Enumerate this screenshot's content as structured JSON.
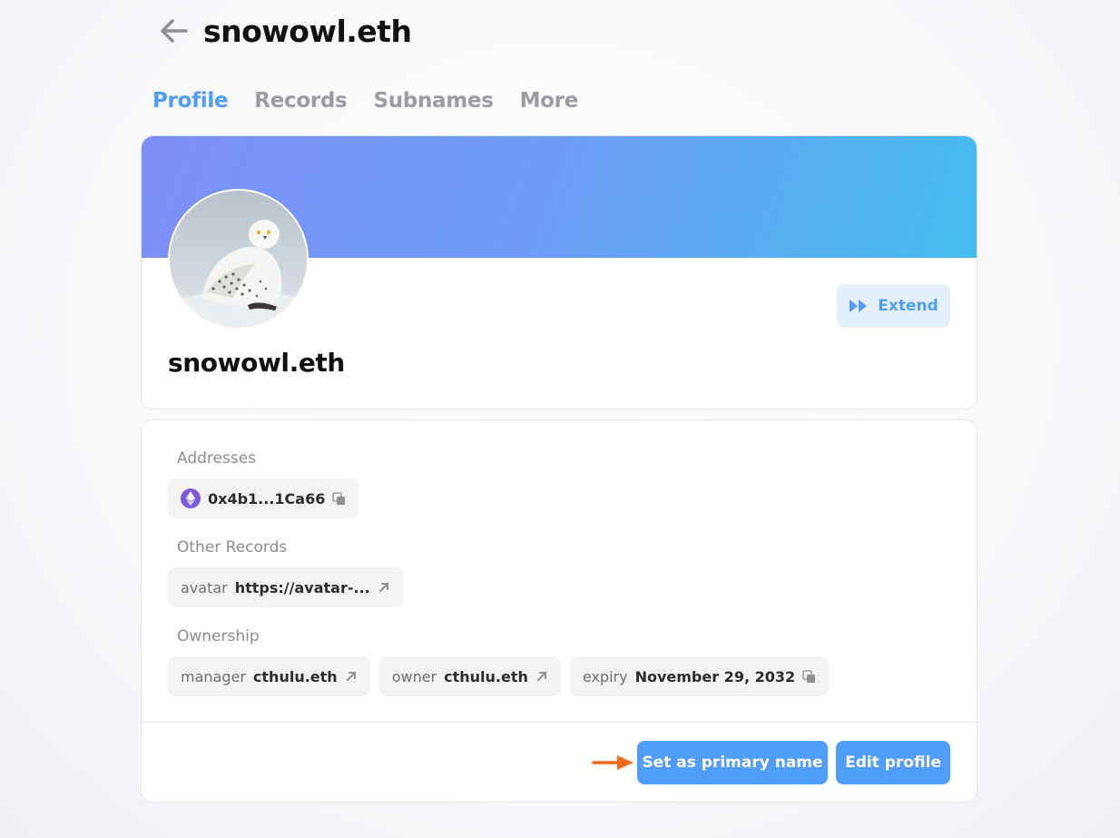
{
  "header": {
    "title": "snowowl.eth",
    "back_icon": "arrow-left-icon"
  },
  "tabs": [
    {
      "label": "Profile",
      "active": true
    },
    {
      "label": "Records",
      "active": false
    },
    {
      "label": "Subnames",
      "active": false
    },
    {
      "label": "More",
      "active": false
    }
  ],
  "profile": {
    "name": "snowowl.eth",
    "extend_label": "Extend",
    "extend_icon": "fast-forward-icon",
    "banner_colors": [
      "#7f8ff7",
      "#44bdee"
    ]
  },
  "addresses": {
    "label": "Addresses",
    "items": [
      {
        "icon": "ethereum-icon",
        "value": "0x4b1...1Ca66"
      }
    ]
  },
  "other_records": {
    "label": "Other Records",
    "items": [
      {
        "key": "avatar",
        "value": "https://avatar-..."
      }
    ]
  },
  "ownership": {
    "label": "Ownership",
    "items": [
      {
        "key": "manager",
        "value": "cthulu.eth"
      },
      {
        "key": "owner",
        "value": "cthulu.eth"
      },
      {
        "key": "expiry",
        "value": "November 29, 2032"
      }
    ]
  },
  "actions": {
    "set_primary_label": "Set as primary name",
    "edit_profile_label": "Edit profile"
  },
  "colors": {
    "accent": "#4f9cf9",
    "annotation_arrow": "#f26b1d"
  }
}
